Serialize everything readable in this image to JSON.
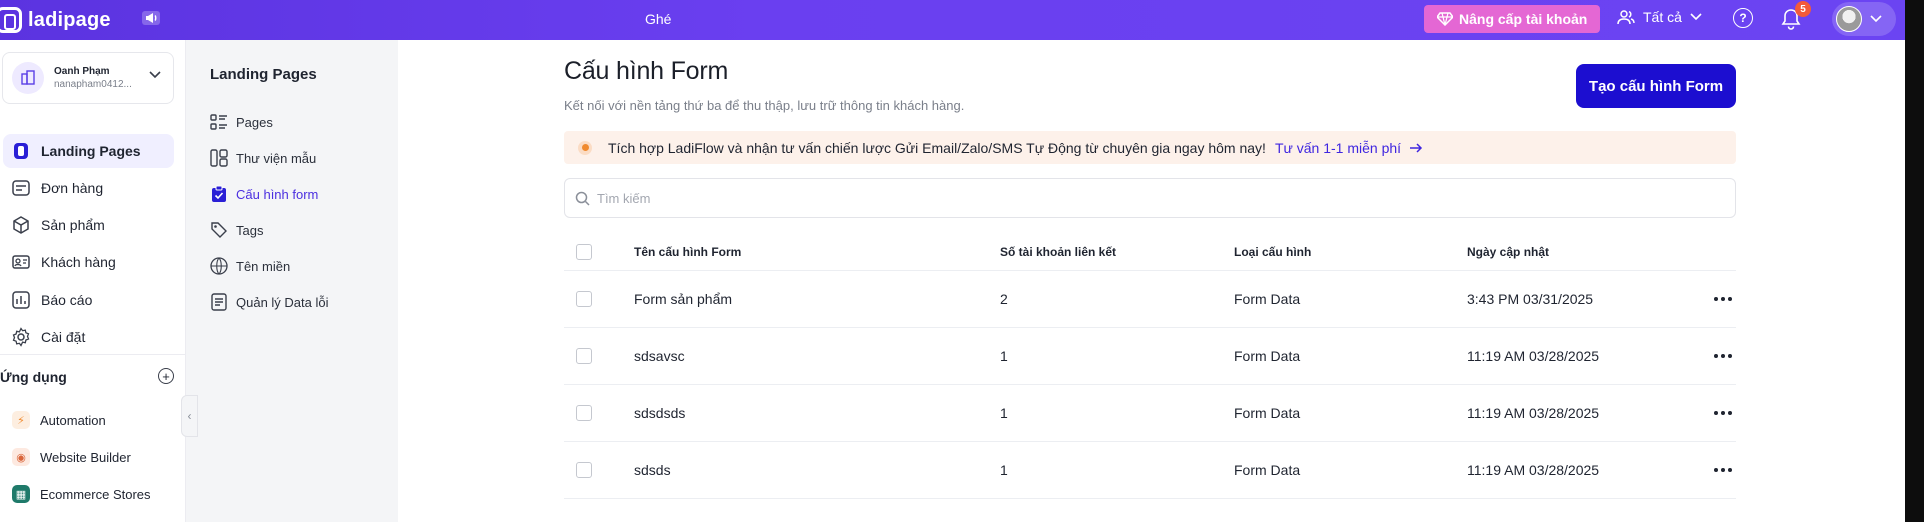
{
  "app": {
    "logo_text": "ladipage",
    "center_text": "Ghé"
  },
  "topbar": {
    "upgrade_label": "Nâng cấp tài khoản",
    "filter_label": "Tất cả",
    "notification_count": "5"
  },
  "account": {
    "name": "Oanh Phạm",
    "email": "nanapham0412..."
  },
  "nav": {
    "items": [
      {
        "label": "Landing Pages",
        "icon": "landing-pages-icon"
      },
      {
        "label": "Đơn hàng",
        "icon": "orders-icon"
      },
      {
        "label": "Sản phẩm",
        "icon": "box-icon"
      },
      {
        "label": "Khách hàng",
        "icon": "customer-card-icon"
      },
      {
        "label": "Báo cáo",
        "icon": "report-icon"
      },
      {
        "label": "Cài đặt",
        "icon": "gear-icon"
      }
    ],
    "apps_title": "Ứng dụng",
    "apps": [
      {
        "label": "Automation",
        "icon": "bolt-icon",
        "color": "#f5a35c"
      },
      {
        "label": "Website Builder",
        "icon": "globe-icon",
        "color": "#e8845a"
      },
      {
        "label": "Ecommerce Stores",
        "icon": "store-icon",
        "color": "#1f7a6a"
      }
    ]
  },
  "subnav": {
    "title": "Landing Pages",
    "items": [
      {
        "label": "Pages",
        "icon": "pages-list-icon"
      },
      {
        "label": "Thư viện mẫu",
        "icon": "template-library-icon"
      },
      {
        "label": "Cấu hình form",
        "icon": "clipboard-icon"
      },
      {
        "label": "Tags",
        "icon": "tag-icon"
      },
      {
        "label": "Tên miền",
        "icon": "www-globe-icon"
      },
      {
        "label": "Quản lý Data lỗi",
        "icon": "document-icon"
      }
    ]
  },
  "main": {
    "title": "Cấu hình Form",
    "description": "Kết nối với nền tảng thứ ba để thu thập, lưu trữ thông tin khách hàng.",
    "create_button": "Tạo cấu hình Form",
    "banner": {
      "text": "Tích hợp LadiFlow và nhận tư vấn chiến lược Gửi Email/Zalo/SMS Tự Động từ chuyên gia ngay hôm nay!",
      "link": "Tư vấn 1-1 miễn phí"
    },
    "search_placeholder": "Tìm kiếm",
    "table": {
      "columns": [
        "Tên cấu hình Form",
        "Số tài khoản liên kết",
        "Loại cấu hình",
        "Ngày cập nhật"
      ],
      "rows": [
        [
          "Form sản phẩm",
          "2",
          "Form Data",
          "3:43 PM 03/31/2025"
        ],
        [
          "sdsavsc",
          "1",
          "Form Data",
          "11:19 AM 03/28/2025"
        ],
        [
          "sdsdsds",
          "1",
          "Form Data",
          "11:19 AM 03/28/2025"
        ],
        [
          "sdsds",
          "1",
          "Form Data",
          "11:19 AM 03/28/2025"
        ]
      ]
    }
  },
  "colors": {
    "topbar": "#6a3ff0",
    "primary_button": "#1c0ed0",
    "upgrade_button": "#e467d4",
    "active_link": "#4b2fe0",
    "banner_bg": "#fdf1ea"
  }
}
